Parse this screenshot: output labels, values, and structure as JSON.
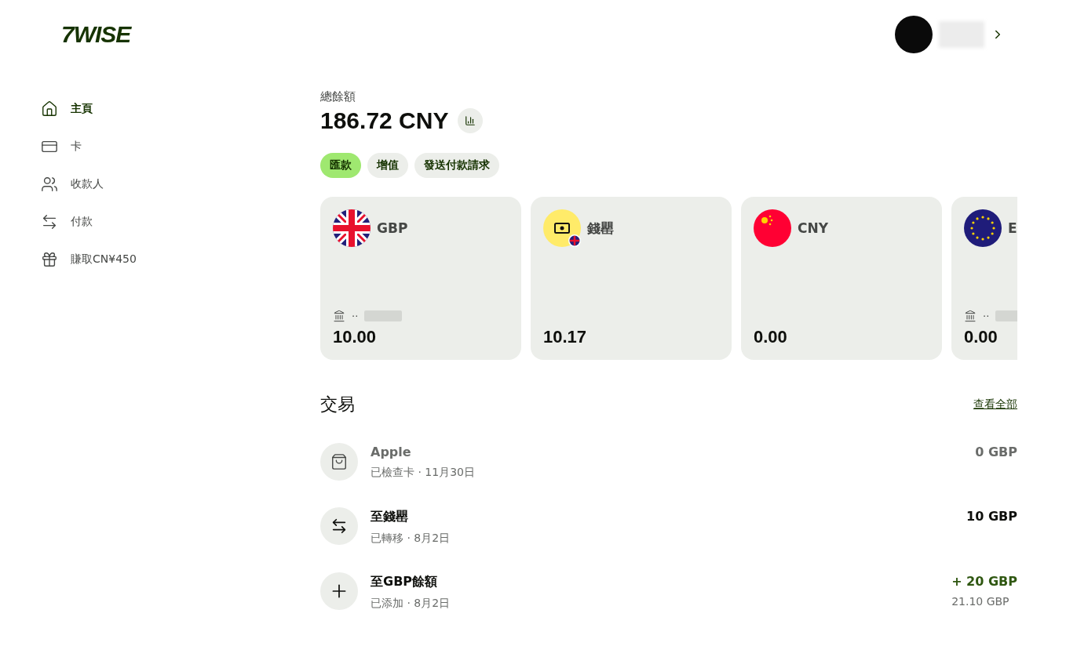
{
  "logo": "7WISE",
  "nav": [
    {
      "label": "主頁",
      "kind": "home",
      "selected": true
    },
    {
      "label": "卡",
      "kind": "card",
      "selected": false
    },
    {
      "label": "收款人",
      "kind": "people",
      "selected": false
    },
    {
      "label": "付款",
      "kind": "payments",
      "selected": false
    },
    {
      "label": "賺取CN¥450",
      "kind": "gift",
      "selected": false
    }
  ],
  "balance": {
    "label": "總餘額",
    "amount": "186.72 CNY"
  },
  "actions": [
    {
      "label": "匯款",
      "selected": true
    },
    {
      "label": "增值",
      "selected": false
    },
    {
      "label": "發送付款請求",
      "selected": false
    }
  ],
  "accounts": [
    {
      "kind": "gb",
      "name": "GBP",
      "account_mask": "··",
      "amount": "10.00"
    },
    {
      "kind": "jar",
      "name": "錢罌",
      "amount": "10.17"
    },
    {
      "kind": "cn",
      "name": "CNY",
      "amount": "0.00"
    },
    {
      "kind": "eu",
      "name": "E",
      "account_mask": "··",
      "amount": "0.00"
    }
  ],
  "transactions": {
    "title": "交易",
    "see_all": "查看全部",
    "items": [
      {
        "kind": "bag",
        "title": "Apple",
        "subtitle": "已檢查卡 · 11月30日",
        "amount": "0 GBP",
        "muted": true,
        "positive": false
      },
      {
        "kind": "transfer",
        "title": "至錢罌",
        "subtitle": "已轉移 · 8月2日",
        "amount": "10 GBP",
        "muted": false,
        "positive": false
      },
      {
        "kind": "add",
        "title": "至GBP餘額",
        "subtitle": "已添加 · 8月2日",
        "amount": "+ 20 GBP",
        "muted": false,
        "positive": true,
        "balance_after": "21.10 GBP"
      }
    ]
  }
}
